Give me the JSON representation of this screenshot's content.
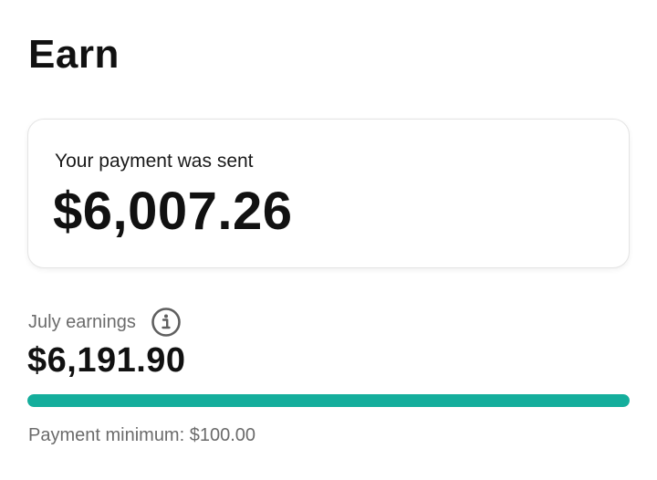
{
  "header": {
    "title": "Earn"
  },
  "payment_card": {
    "label": "Your payment was sent",
    "amount": "$6,007.26"
  },
  "earnings": {
    "label": "July earnings",
    "info_icon": "info-icon",
    "amount": "$6,191.90",
    "progress_fraction": 1.0,
    "minimum_text": "Payment minimum: $100.00"
  },
  "colors": {
    "progress": "#14ae9c",
    "text_primary": "#111111",
    "text_secondary": "#6b6b6b"
  }
}
